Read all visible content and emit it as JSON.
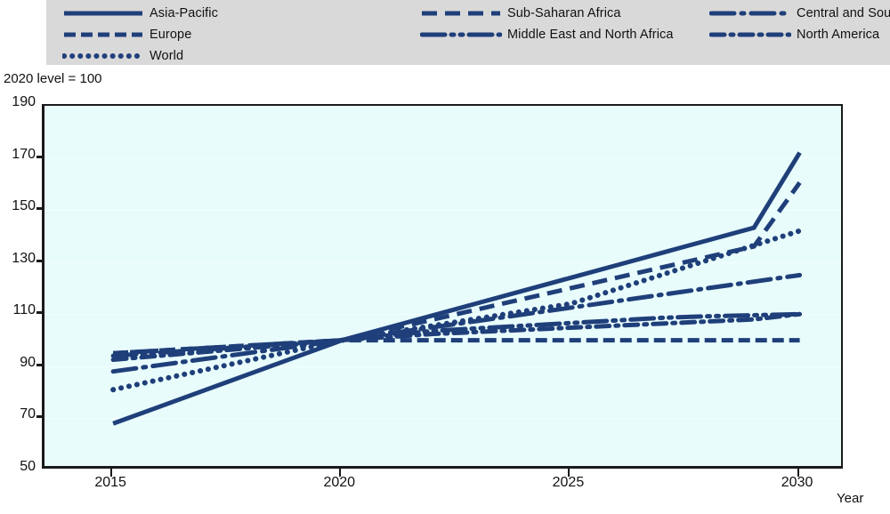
{
  "legend": {
    "items": [
      {
        "label": "Asia-Pacific",
        "style": "solid"
      },
      {
        "label": "Sub-Saharan Africa",
        "style": "dashed"
      },
      {
        "label": "Central and South America",
        "style": "long-dash-dot"
      },
      {
        "label": "Europe",
        "style": "dash-short"
      },
      {
        "label": "Middle East and North Africa",
        "style": "long-dash-dot-dot"
      },
      {
        "label": "North America",
        "style": "dash-dot"
      },
      {
        "label": "World",
        "style": "dotted"
      }
    ]
  },
  "axes": {
    "y_title": "2020 level = 100",
    "x_title": "Year",
    "y_ticks": [
      "190",
      "170",
      "150",
      "130",
      "110",
      "90",
      "70",
      "50"
    ],
    "x_ticks": [
      "2015",
      "2020",
      "2025",
      "2030"
    ]
  },
  "colors": {
    "series": "#1f3f7a",
    "plot_background": "#e8fcfb",
    "legend_background": "#d9d9d9",
    "axis": "#1a1a1a",
    "gridline": "#f4feff"
  },
  "chart_data": {
    "type": "line",
    "title": "",
    "subtitle": "",
    "xlabel": "Year",
    "ylabel": "2020 level = 100",
    "xlim": [
      2013.5,
      2031
    ],
    "ylim": [
      50,
      190
    ],
    "ytick_step": 20,
    "grid": true,
    "legend_position": "top",
    "x": [
      2015,
      2016,
      2017,
      2018,
      2019,
      2020,
      2021,
      2022,
      2023,
      2024,
      2025,
      2026,
      2027,
      2028,
      2029,
      2030
    ],
    "series": [
      {
        "name": "Asia-Pacific",
        "linestyle": "solid",
        "values": [
          68.0,
          74.4,
          80.8,
          87.2,
          93.6,
          100.0,
          104.8,
          109.6,
          114.4,
          119.2,
          124.0,
          128.8,
          133.6,
          138.4,
          143.2,
          172.0
        ]
      },
      {
        "name": "Sub-Saharan Africa",
        "linestyle": "dashed",
        "values": [
          95.0,
          96.0,
          97.0,
          98.0,
          99.0,
          100.0,
          104.0,
          108.0,
          112.0,
          116.0,
          120.0,
          124.0,
          128.0,
          132.0,
          136.0,
          160.5
        ]
      },
      {
        "name": "World",
        "linestyle": "dotted",
        "values": [
          81.0,
          84.8,
          88.6,
          92.4,
          96.2,
          100.0,
          102.8,
          105.6,
          108.4,
          111.2,
          114.0,
          119.6,
          125.2,
          130.8,
          136.4,
          142.0
        ]
      },
      {
        "name": "Central and South America",
        "linestyle": "long-dash-dot",
        "values": [
          88.0,
          90.4,
          92.8,
          95.2,
          97.6,
          100.0,
          102.5,
          105.0,
          107.5,
          110.0,
          112.5,
          115.0,
          117.5,
          120.0,
          122.5,
          125.0
        ]
      },
      {
        "name": "Middle East and North Africa",
        "linestyle": "long-dash-dot-dot",
        "values": [
          94.0,
          95.2,
          96.4,
          97.6,
          98.8,
          100.0,
          101.8,
          103.6,
          104.6,
          105.6,
          106.6,
          107.6,
          108.6,
          109.2,
          109.6,
          110.0
        ]
      },
      {
        "name": "North America",
        "linestyle": "dash-dot",
        "values": [
          92.5,
          94.0,
          95.5,
          97.0,
          98.5,
          100.0,
          101.2,
          102.4,
          103.2,
          104.0,
          104.8,
          105.6,
          106.4,
          107.2,
          108.0,
          110.0
        ]
      },
      {
        "name": "Europe",
        "linestyle": "dash-short",
        "values": [
          95.0,
          96.0,
          97.0,
          98.0,
          99.0,
          100.0,
          100.0,
          100.0,
          100.0,
          100.0,
          100.0,
          100.0,
          100.0,
          100.0,
          100.0,
          100.0
        ]
      }
    ]
  }
}
